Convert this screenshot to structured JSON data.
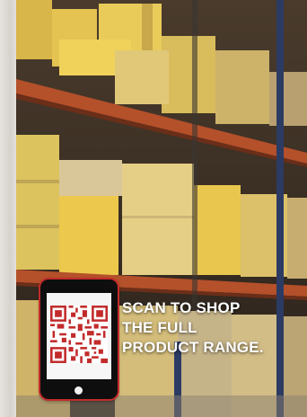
{
  "cta": {
    "line1": "SCAN TO SHOP",
    "line2": "THE FULL",
    "line3": "PRODUCT RANGE."
  },
  "colors": {
    "accent": "#c22b2b",
    "box_yellow": "#e8c547",
    "rack_orange": "#b4502a",
    "text": "#ffffff"
  },
  "icons": {
    "qr": "qr-code-icon",
    "tablet": "tablet-icon"
  }
}
